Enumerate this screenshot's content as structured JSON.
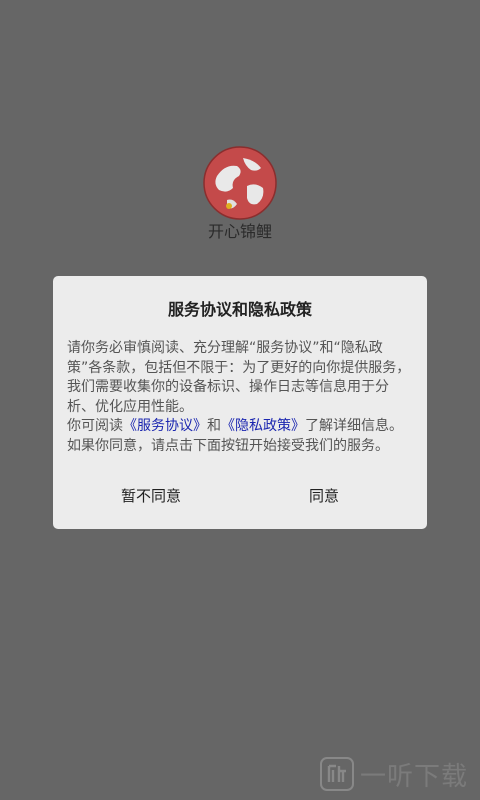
{
  "app": {
    "name": "开心锦鲤",
    "logo_icon": "red-globe-icon"
  },
  "dialog": {
    "title": "服务协议和隐私政策",
    "paragraph1": "请你务必审慎阅读、充分理解“服务协议”和“隐私政策”各条款，包括但不限于：为了更好的向你提供服务，我们需要收集你的设备标识、操作日志等信息用于分析、优化应用性能。",
    "p2_prefix": "你可阅读",
    "p2_link1": "《服务协议》",
    "p2_and": "和",
    "p2_link2": "《隐私政策》",
    "p2_suffix": "了解详细信息。如果你同意，请点击下面按钮开始接受我们的服务。",
    "disagree_label": "暂不同意",
    "agree_label": "同意",
    "link_color": "#1c27b0"
  },
  "watermark": {
    "icon": "listen-logo-icon",
    "text": "一听下载"
  }
}
